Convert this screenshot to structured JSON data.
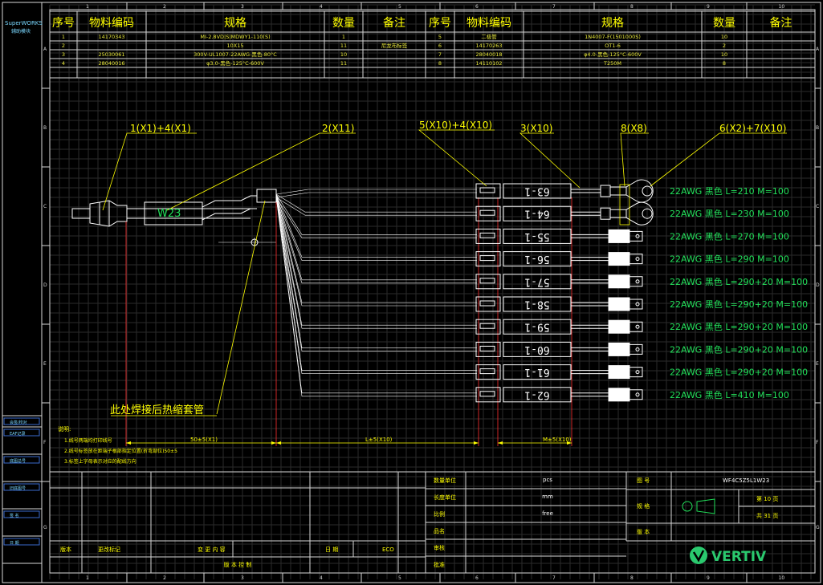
{
  "app": {
    "brand": "SuperWORKS",
    "brand_sub": "辅助模块"
  },
  "colors": {
    "frame": "#d7d7d7",
    "grid": "#2b2b2b",
    "table_text": "#e8e83a",
    "header_text": "#ffff00",
    "green": "#22e05a",
    "white": "#ffffff",
    "cyan": "#00d7d7",
    "logo": "#2ac96e"
  },
  "bom": {
    "headers": [
      "序号",
      "物料编码",
      "规格",
      "数量",
      "备注",
      "序号",
      "物料编码",
      "规格",
      "数量",
      "备注"
    ],
    "rows": [
      [
        "1",
        "14170343",
        "MI-2.8VD|S|MDWY1-110(S)",
        "1",
        "",
        "5",
        "二极管",
        "1N4007-F(1501000S)",
        "10",
        ""
      ],
      [
        "2",
        "",
        "10X15",
        "11",
        "尼龙布标签",
        "6",
        "14170263",
        "OT1-6",
        "2",
        ""
      ],
      [
        "3",
        "25030061",
        "300V-UL1007-22AWG-黑色-80°C",
        "10",
        "",
        "7",
        "28040018",
        "φ4.0-黑色-125°C-600V",
        "10",
        ""
      ],
      [
        "4",
        "28040016",
        "φ3.0-黑色-125°C-600V",
        "11",
        "",
        "8",
        "14110102",
        "T250M",
        "8",
        ""
      ]
    ]
  },
  "grid": {
    "cols": [
      "1",
      "2",
      "3",
      "4",
      "5",
      "6",
      "7",
      "8",
      "9",
      "10"
    ],
    "rows": [
      "A",
      "B",
      "C",
      "D",
      "E",
      "F",
      "G"
    ]
  },
  "left_bar": [
    "会签/校对",
    "EA&#x46;",
    "底图总号",
    "旧底图号",
    "签 名",
    "日 期"
  ],
  "callouts": {
    "c1": "1(X1)+4(X1)",
    "c2": "2(X11)",
    "c3": "5(X10)+4(X10)",
    "c4": "3(X10)",
    "c5": "8(X8)",
    "c6": "6(X2)+7(X10)",
    "weld": "此处焊接后热缩套管",
    "sleeve": "W23"
  },
  "wires": [
    {
      "tag": "63-1",
      "spec": "22AWG 黑色 L=210 M=100",
      "term": "ring"
    },
    {
      "tag": "64-1",
      "spec": "22AWG 黑色 L=230 M=100",
      "term": "ring"
    },
    {
      "tag": "55-1",
      "spec": "22AWG 黑色 L=270 M=100",
      "term": "tab"
    },
    {
      "tag": "56-1",
      "spec": "22AWG 黑色 L=290 M=100",
      "term": "tab"
    },
    {
      "tag": "57-1",
      "spec": "22AWG 黑色 L=290+20 M=100",
      "term": "tab"
    },
    {
      "tag": "58-1",
      "spec": "22AWG 黑色 L=290+20 M=100",
      "term": "tab"
    },
    {
      "tag": "59-1",
      "spec": "22AWG 黑色 L=290+20 M=100",
      "term": "tab"
    },
    {
      "tag": "60-1",
      "spec": "22AWG 黑色 L=290+20 M=100",
      "term": "tab"
    },
    {
      "tag": "61-1",
      "spec": "22AWG 黑色 L=290+20 M=100",
      "term": "tab"
    },
    {
      "tag": "62-1",
      "spec": "22AWG 黑色 L=410 M=100",
      "term": "tab"
    }
  ],
  "dims": {
    "d1": "50±5(X1)",
    "d2": "L±5(X10)",
    "d3": "M±5(X10)"
  },
  "notes": {
    "title": "说明:",
    "lines": [
      "1.线号两端均打印线号",
      "2.线号标签放在距端子根部指定位置(折弯部位)50±5",
      "3.标签上字母表示对应的配线方向"
    ]
  },
  "title_block": {
    "labels_mid": [
      "数量单位",
      "长度单位",
      "比例",
      "品名",
      "审核",
      "批准"
    ],
    "values_mid": [
      "pcs",
      "mm",
      "free",
      "",
      "",
      ""
    ],
    "labels_right": [
      "图 号",
      "规 格",
      "版 本"
    ],
    "drawing_no": "WF4C5Z5L1W23",
    "sheet": "第 10 页",
    "total": "共 31 页",
    "rev_row": [
      "版本",
      "更改标记",
      "变 更 内 容",
      "日 期",
      "ECO"
    ],
    "rev_foot": "版   本   控   制",
    "logo_text": "VERTIV"
  }
}
